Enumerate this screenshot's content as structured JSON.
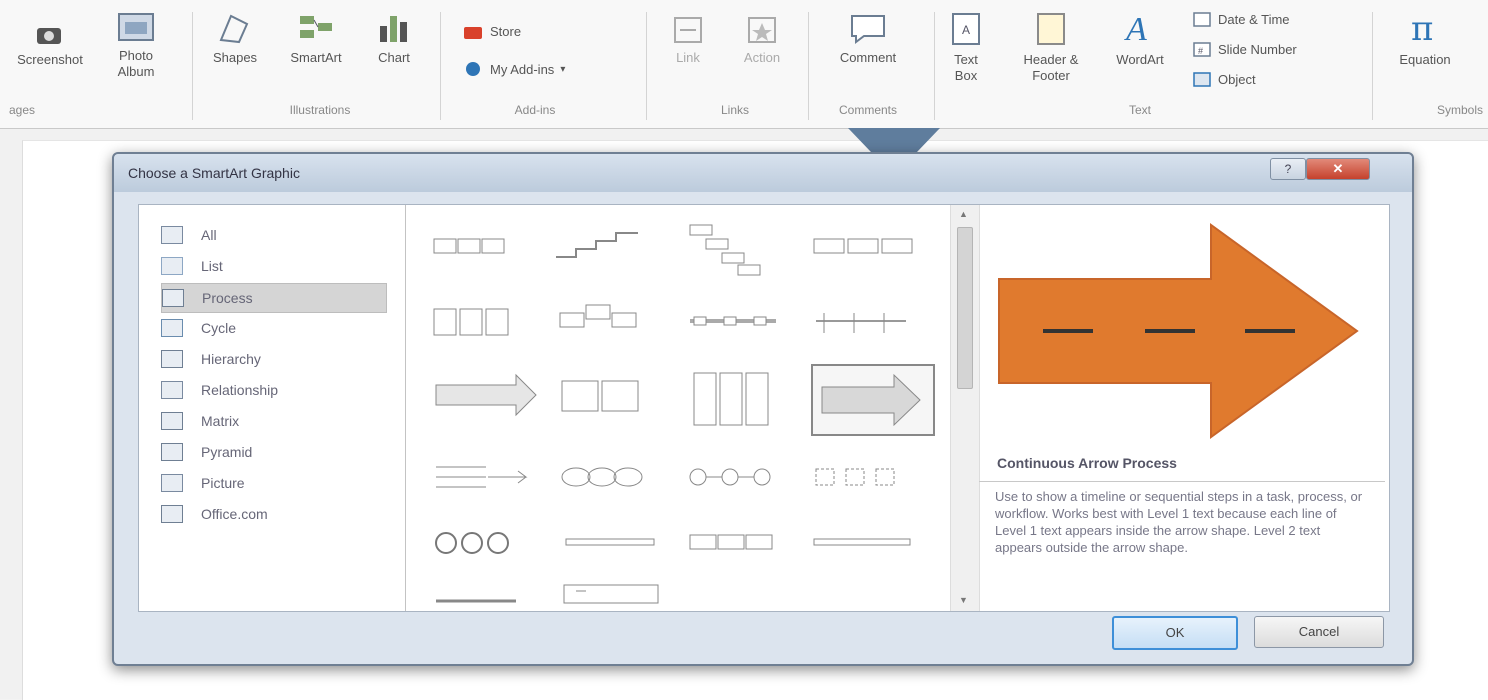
{
  "ribbon": {
    "screenshot_label": "Screenshot",
    "photo_album_label": "Photo Album",
    "shapes_label": "Shapes",
    "smartart_label": "SmartArt",
    "chart_label": "Chart",
    "store_label": "Store",
    "my_addins_label": "My Add-ins",
    "link_label": "Link",
    "action_label": "Action",
    "comment_label": "Comment",
    "textbox_label": "Text Box",
    "header_footer_label": "Header & Footer",
    "wordart_label": "WordArt",
    "date_time_label": "Date & Time",
    "slide_number_label": "Slide Number",
    "object_label": "Object",
    "equation_label": "Equation",
    "groups": {
      "images": "ages",
      "illustrations": "Illustrations",
      "addins": "Add-ins",
      "links": "Links",
      "comments": "Comments",
      "text": "Text",
      "symbols": "Symbols"
    }
  },
  "dialog": {
    "title": "Choose a SmartArt Graphic",
    "categories": [
      {
        "label": "All",
        "icon": "all-icon"
      },
      {
        "label": "List",
        "icon": "list-icon"
      },
      {
        "label": "Process",
        "icon": "process-icon",
        "selected": true
      },
      {
        "label": "Cycle",
        "icon": "cycle-icon"
      },
      {
        "label": "Hierarchy",
        "icon": "hierarchy-icon"
      },
      {
        "label": "Relationship",
        "icon": "relationship-icon"
      },
      {
        "label": "Matrix",
        "icon": "matrix-icon"
      },
      {
        "label": "Pyramid",
        "icon": "pyramid-icon"
      },
      {
        "label": "Picture",
        "icon": "picture-icon"
      },
      {
        "label": "Office.com",
        "icon": "office-com-icon"
      }
    ],
    "selected_layout_name": "Continuous Arrow Process",
    "selected_layout_description": "Use to show a timeline or sequential steps in a task, process, or workflow. Works best with Level 1 text because each line of Level 1 text appears inside the arrow shape. Level 2 text appears outside the arrow shape.",
    "ok_label": "OK",
    "cancel_label": "Cancel"
  },
  "colors": {
    "arrow_orange": "#e07a2e",
    "arrow_dark": "#b4561a",
    "selection_blue": "#3e8fd8"
  }
}
